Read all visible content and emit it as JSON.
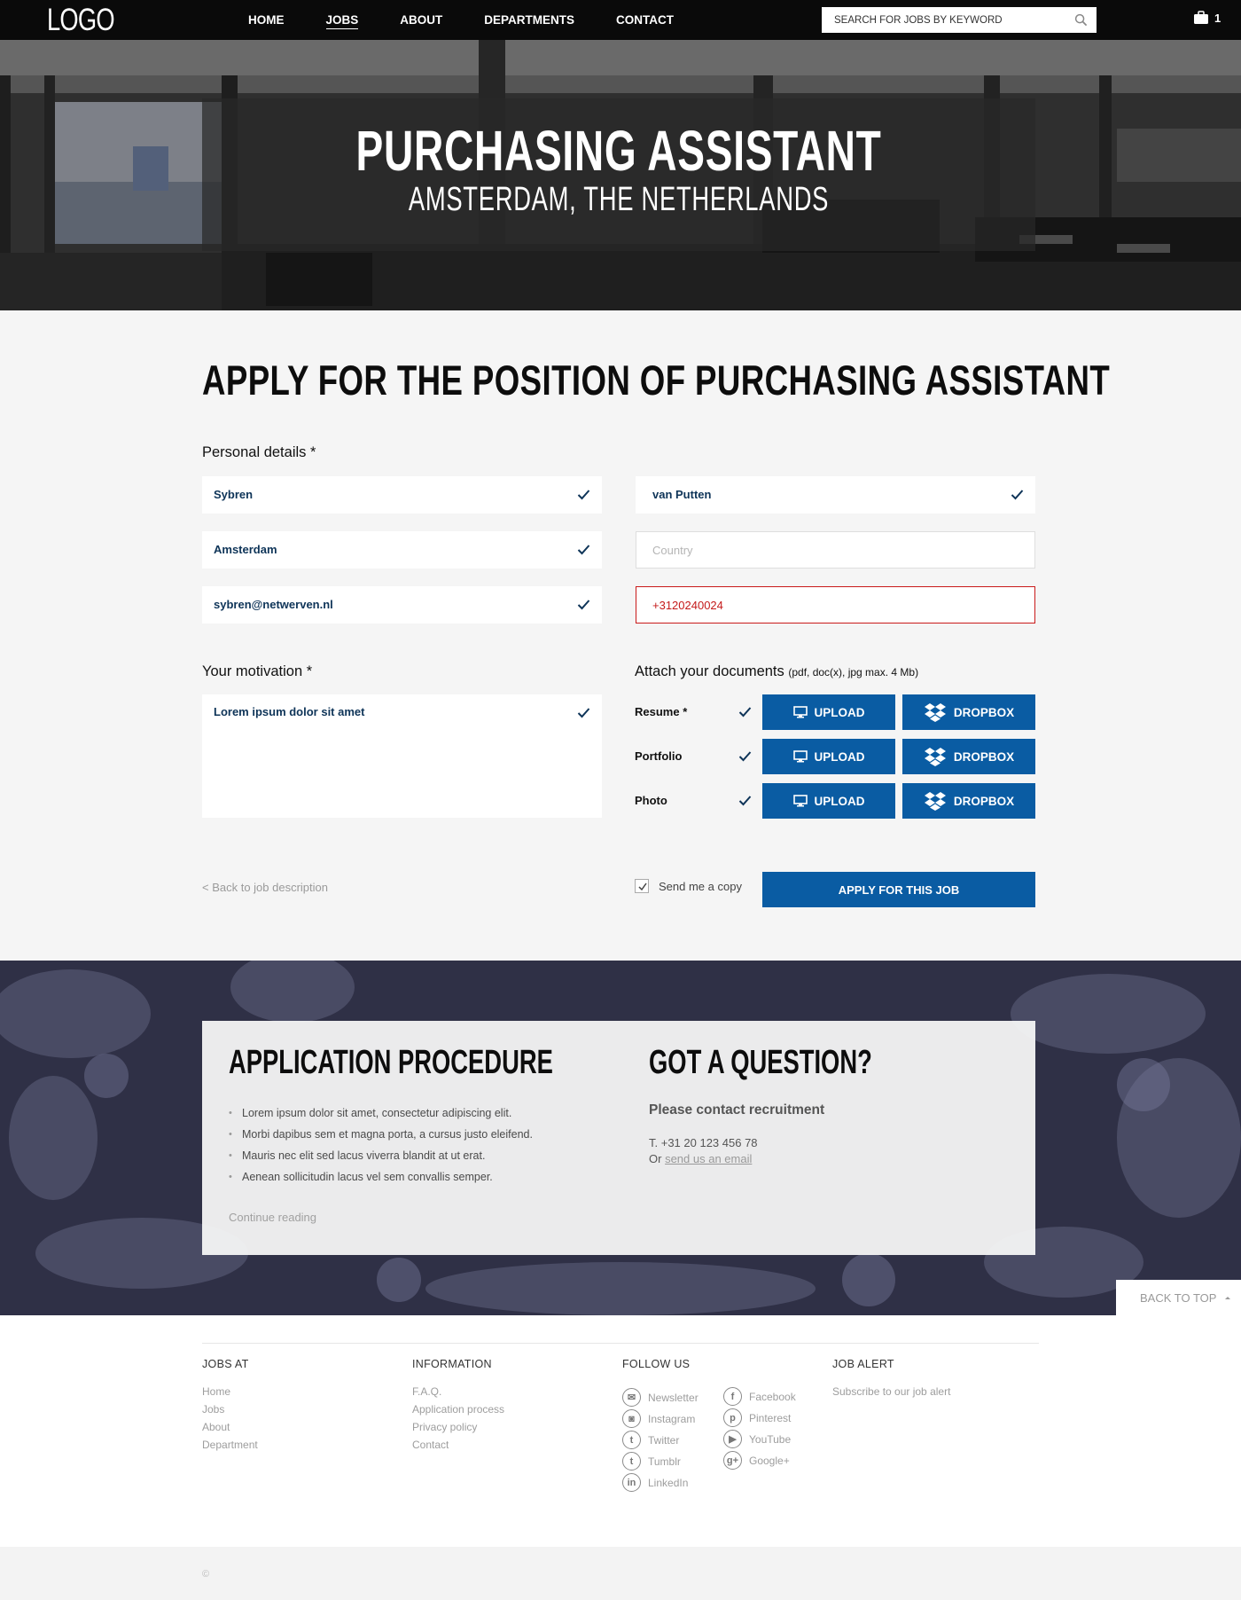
{
  "nav": {
    "logo": "LOGO",
    "links": [
      "HOME",
      "JOBS",
      "ABOUT",
      "DEPARTMENTS",
      "CONTACT"
    ],
    "active": "JOBS",
    "search_placeholder": "SEARCH FOR JOBS BY KEYWORD",
    "cart_count": "1"
  },
  "hero": {
    "title": "PURCHASING ASSISTANT",
    "subtitle": "AMSTERDAM, THE NETHERLANDS"
  },
  "form": {
    "heading": "APPLY FOR THE POSITION OF PURCHASING ASSISTANT",
    "personal_label": "Personal details *",
    "first_name": "Sybren",
    "last_name": "van Putten",
    "city": "Amsterdam",
    "country_placeholder": "Country",
    "email": "sybren@netwerven.nl",
    "phone": "+3120240024",
    "motivation_label": "Your motivation *",
    "motivation": "Lorem ipsum dolor sit amet",
    "attach_label": "Attach your documents",
    "attach_hint": "(pdf, doc(x), jpg max. 4 Mb)",
    "documents": [
      {
        "label": "Resume *"
      },
      {
        "label": "Portfolio"
      },
      {
        "label": "Photo"
      }
    ],
    "upload_label": "UPLOAD",
    "dropbox_label": "DROPBOX",
    "back_link": "<  Back to job description",
    "send_copy": "Send me a copy",
    "apply_button": "APPLY FOR THIS JOB"
  },
  "procedure": {
    "title": "APPLICATION PROCEDURE",
    "items": [
      "Lorem ipsum dolor sit amet, consectetur adipiscing elit.",
      "Morbi dapibus sem et magna porta, a cursus justo eleifend.",
      "Mauris nec elit sed lacus viverra blandit at ut erat.",
      "Aenean sollicitudin lacus vel sem convallis semper."
    ],
    "continue": "Continue reading"
  },
  "question": {
    "title": "GOT A QUESTION?",
    "subtitle": "Please contact recruitment",
    "phone": "T. +31 20 123 456 78",
    "or": "Or",
    "email_link": "send us an email"
  },
  "back_to_top": "BACK TO TOP",
  "footer": {
    "jobs_at": {
      "title": "JOBS AT",
      "links": [
        "Home",
        "Jobs",
        "About",
        "Department"
      ]
    },
    "information": {
      "title": "INFORMATION",
      "links": [
        "F.A.Q.",
        "Application process",
        "Privacy policy",
        "Contact"
      ]
    },
    "follow": {
      "title": "FOLLOW US",
      "left": [
        "Newsletter",
        "Instagram",
        "Twitter",
        "Tumblr",
        "LinkedIn"
      ],
      "right": [
        "Facebook",
        "Pinterest",
        "YouTube",
        "Google+"
      ]
    },
    "job_alert": {
      "title": "JOB ALERT",
      "text": "Subscribe to our job alert"
    },
    "copyright": "©"
  },
  "colors": {
    "accent": "#0a5ca3",
    "error": "#c91a1a"
  }
}
